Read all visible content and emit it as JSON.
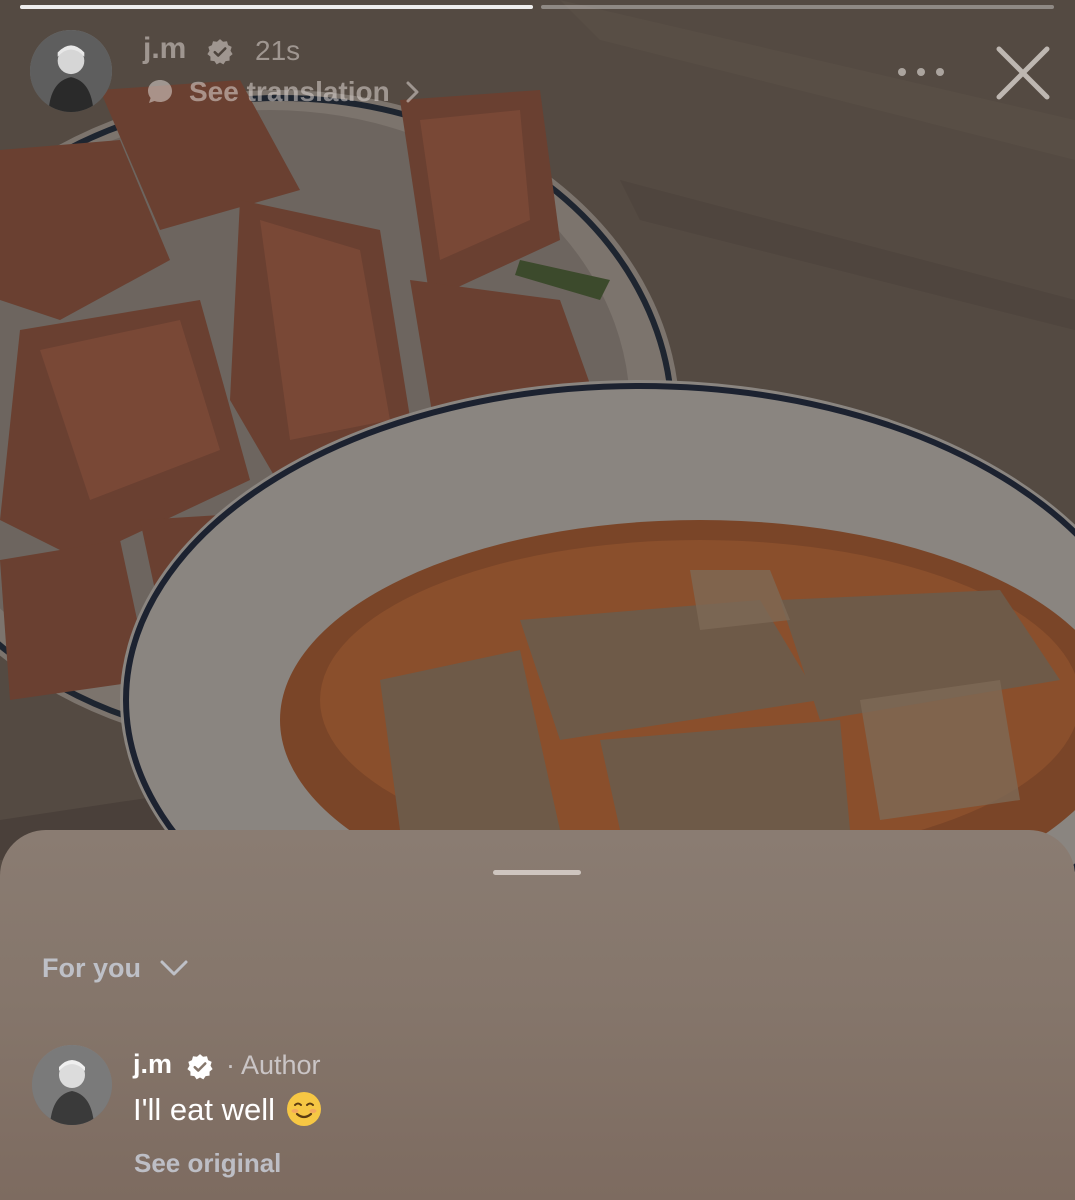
{
  "story": {
    "progress": [
      1.0,
      0.0
    ],
    "image_description_icon": "food-photo"
  },
  "header": {
    "username": "j.m",
    "verified_icon": "verified-badge-icon",
    "time": "21s",
    "translation_label": "See translation",
    "more_icon": "more-dots-icon",
    "close_icon": "close-icon"
  },
  "sheet": {
    "filter_label": "For you",
    "comment": {
      "username": "j.m",
      "author_label": "· Author",
      "text": "I'll eat well",
      "emoji": "☺️",
      "see_original": "See original"
    }
  },
  "colors": {
    "sheet_top": "#8a7c72",
    "sheet_bottom": "#7d6b60",
    "emoji_face": "#f6c744",
    "text_primary": "#ffffff",
    "text_muted": "#c8cdd7"
  }
}
